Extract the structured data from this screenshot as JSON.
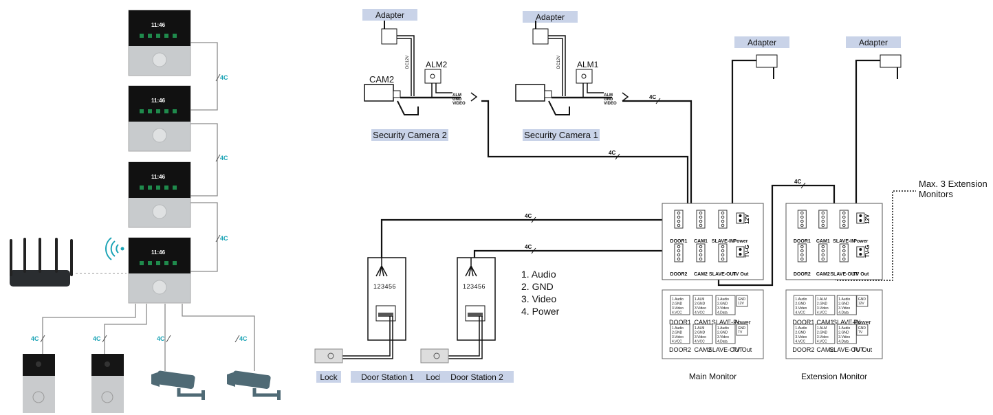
{
  "left_system": {
    "monitor_time": "11:46",
    "cable_label": "4C"
  },
  "cameras": [
    {
      "title": "CAM2",
      "alarm": "ALM2",
      "name": "Security Camera 2",
      "adapter": "Adapter",
      "power_label": "DC12V"
    },
    {
      "title": "",
      "alarm": "ALM1",
      "name": "Security Camera 1",
      "adapter": "Adapter",
      "power_label": "DC12V"
    }
  ],
  "camera_wires": [
    "ALM",
    "GND",
    "VIDEO"
  ],
  "cable_label": "4C",
  "door_stations": [
    {
      "name": "Door Station 1",
      "lock": "Lock",
      "terminals": "123456"
    },
    {
      "name": "Door Station 2",
      "lock": "Lock",
      "terminals": "123456"
    }
  ],
  "wire_legend": [
    "1. Audio",
    "2. GND",
    "3. Video",
    "4. Power"
  ],
  "monitor_adapters": [
    "Adapter",
    "Adapter"
  ],
  "panel": {
    "row1": [
      "DOOR1",
      "CAM1",
      "SLAVE-IN",
      "Power"
    ],
    "row2": [
      "DOOR2",
      "CAM2",
      "SLAVE-OUT",
      "TV Out"
    ],
    "power_polarity": "- +",
    "power_voltage": "12V",
    "tv_terminal": "TV-G"
  },
  "pin_tables": {
    "door": [
      "1.Audio",
      "2.GND",
      "3.Video",
      "4.VCC"
    ],
    "cam": [
      "1.ALM",
      "2.GND",
      "3.Video",
      "4.VCC"
    ],
    "slave": [
      "1.Audio",
      "2.GND",
      "3.Video",
      "4.Data"
    ],
    "power": [
      "GND",
      "12V"
    ],
    "tvout": [
      "GND",
      "TV"
    ]
  },
  "monitors": [
    {
      "name": "Main Monitor"
    },
    {
      "name": "Extension Monitor"
    }
  ],
  "extension_note": [
    "Max. 3 Extension",
    "Monitors"
  ],
  "colors": {
    "label_bg": "#c9d3e8",
    "accent": "#1aa3b5",
    "wire": "#111111",
    "camera_body": "#4f6a75"
  }
}
